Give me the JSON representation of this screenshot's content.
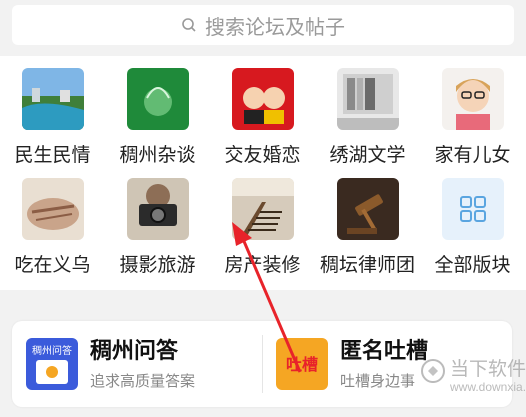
{
  "search": {
    "placeholder": "搜索论坛及帖子"
  },
  "forums_row1": [
    {
      "label": "民生民情"
    },
    {
      "label": "稠州杂谈"
    },
    {
      "label": "交友婚恋"
    },
    {
      "label": "绣湖文学"
    },
    {
      "label": "家有儿女"
    }
  ],
  "forums_row2": [
    {
      "label": "吃在义乌"
    },
    {
      "label": "摄影旅游"
    },
    {
      "label": "房产装修"
    },
    {
      "label": "稠坛律师团"
    },
    {
      "label": "全部版块"
    }
  ],
  "qa": {
    "left": {
      "title": "稠州问答",
      "subtitle": "追求高质量答案",
      "icon_text": "稠州问答"
    },
    "right": {
      "title": "匿名吐槽",
      "subtitle": "吐槽身边事",
      "icon_text": "吐槽"
    }
  },
  "watermark": {
    "text": "当下软件园",
    "url": "www.downxia.com"
  },
  "colors": {
    "accent_arrow": "#e8232a",
    "grid_icon_bg": "#e6f1fb",
    "grid_icon_stroke": "#5aa5e0"
  }
}
